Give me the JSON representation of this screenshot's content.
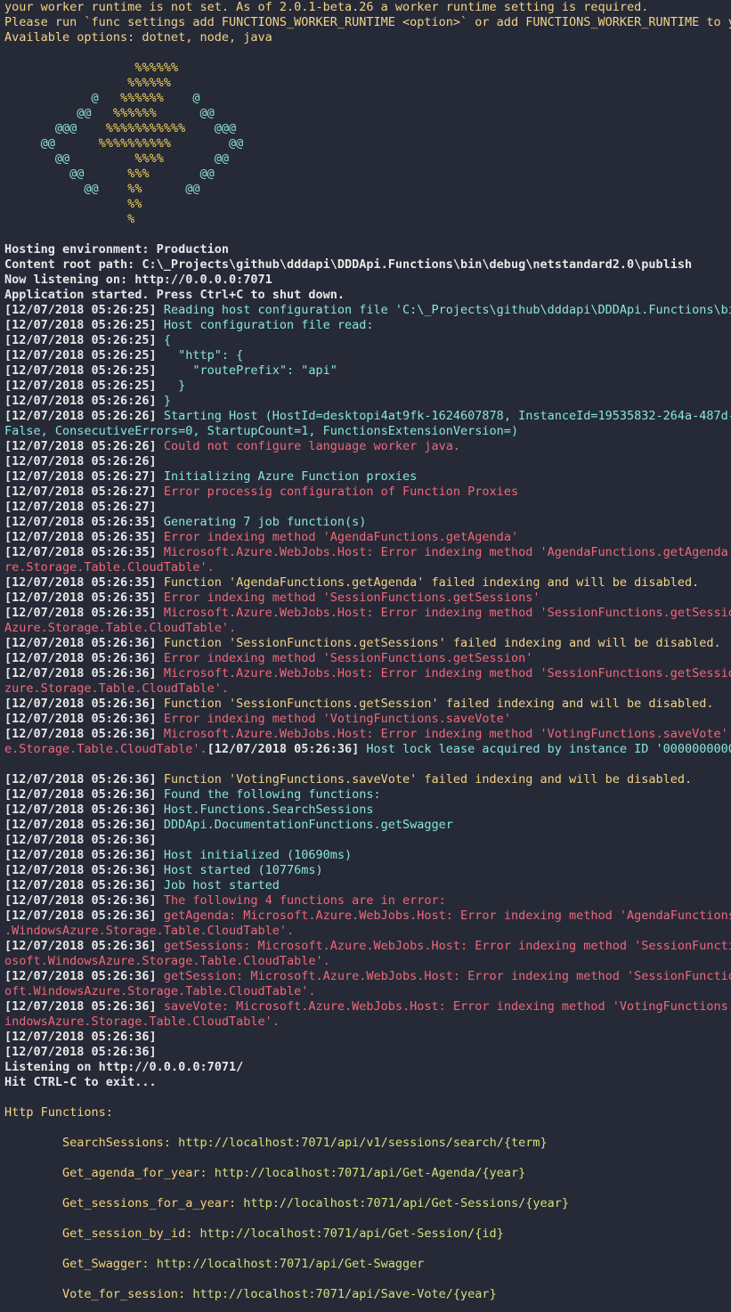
{
  "colors": {
    "background": "#262a36",
    "white": "#e8e8e8",
    "yellow": "#f2d388",
    "cyan": "#86e5dc",
    "red": "#f0677a",
    "lime": "#d2e07a",
    "logo_percent": "#f4d35e",
    "logo_at": "#8ee0d4"
  },
  "lines": [
    [
      {
        "t": "your worker runtime is not set. As of 2.0.1-beta.26 a worker runtime setting is required.",
        "c": "yellow"
      }
    ],
    [
      {
        "t": "Please run `func settings add FUNCTIONS_WORKER_RUNTIME <option>` or add FUNCTIONS_WORKER_RUNTIME to y",
        "c": "yellow"
      }
    ],
    [
      {
        "t": "Available options: dotnet, node, java",
        "c": "yellow"
      }
    ],
    [
      {
        "t": "",
        "c": "white"
      }
    ],
    [
      {
        "t": "                  ",
        "c": "white"
      },
      {
        "t": "%%%%%%",
        "c": "logo-pct"
      }
    ],
    [
      {
        "t": "                 ",
        "c": "white"
      },
      {
        "t": "%%%%%%",
        "c": "logo-pct"
      }
    ],
    [
      {
        "t": "            ",
        "c": "white"
      },
      {
        "t": "@",
        "c": "logo-at"
      },
      {
        "t": "   ",
        "c": "white"
      },
      {
        "t": "%%%%%%",
        "c": "logo-pct"
      },
      {
        "t": "    ",
        "c": "white"
      },
      {
        "t": "@",
        "c": "logo-at"
      }
    ],
    [
      {
        "t": "          ",
        "c": "white"
      },
      {
        "t": "@@",
        "c": "logo-at"
      },
      {
        "t": "   ",
        "c": "white"
      },
      {
        "t": "%%%%%%",
        "c": "logo-pct"
      },
      {
        "t": "      ",
        "c": "white"
      },
      {
        "t": "@@",
        "c": "logo-at"
      }
    ],
    [
      {
        "t": "       ",
        "c": "white"
      },
      {
        "t": "@@@",
        "c": "logo-at"
      },
      {
        "t": "    ",
        "c": "white"
      },
      {
        "t": "%%%%%%%%%%%",
        "c": "logo-pct"
      },
      {
        "t": "    ",
        "c": "white"
      },
      {
        "t": "@@@",
        "c": "logo-at"
      }
    ],
    [
      {
        "t": "     ",
        "c": "white"
      },
      {
        "t": "@@",
        "c": "logo-at"
      },
      {
        "t": "      ",
        "c": "white"
      },
      {
        "t": "%%%%%%%%%%",
        "c": "logo-pct"
      },
      {
        "t": "        ",
        "c": "white"
      },
      {
        "t": "@@",
        "c": "logo-at"
      }
    ],
    [
      {
        "t": "       ",
        "c": "white"
      },
      {
        "t": "@@",
        "c": "logo-at"
      },
      {
        "t": "         ",
        "c": "white"
      },
      {
        "t": "%%%%",
        "c": "logo-pct"
      },
      {
        "t": "       ",
        "c": "white"
      },
      {
        "t": "@@",
        "c": "logo-at"
      }
    ],
    [
      {
        "t": "         ",
        "c": "white"
      },
      {
        "t": "@@",
        "c": "logo-at"
      },
      {
        "t": "      ",
        "c": "white"
      },
      {
        "t": "%%%",
        "c": "logo-pct"
      },
      {
        "t": "       ",
        "c": "white"
      },
      {
        "t": "@@",
        "c": "logo-at"
      }
    ],
    [
      {
        "t": "           ",
        "c": "white"
      },
      {
        "t": "@@",
        "c": "logo-at"
      },
      {
        "t": "    ",
        "c": "white"
      },
      {
        "t": "%%",
        "c": "logo-pct"
      },
      {
        "t": "      ",
        "c": "white"
      },
      {
        "t": "@@",
        "c": "logo-at"
      }
    ],
    [
      {
        "t": "                 ",
        "c": "white"
      },
      {
        "t": "%%",
        "c": "logo-pct"
      }
    ],
    [
      {
        "t": "                 ",
        "c": "white"
      },
      {
        "t": "%",
        "c": "logo-pct"
      }
    ],
    [
      {
        "t": "",
        "c": "white"
      }
    ],
    [
      {
        "t": "Hosting environment: Production",
        "c": "bold-white"
      }
    ],
    [
      {
        "t": "Content root path: C:\\_Projects\\github\\dddapi\\DDDApi.Functions\\bin\\debug\\netstandard2.0\\publish",
        "c": "bold-white"
      }
    ],
    [
      {
        "t": "Now listening on: http://0.0.0.0:7071",
        "c": "bold-white"
      }
    ],
    [
      {
        "t": "Application started. Press Ctrl+C to shut down.",
        "c": "bold-white"
      }
    ],
    [
      {
        "t": "[12/07/2018 05:26:25] ",
        "c": "bold-white"
      },
      {
        "t": "Reading host configuration file 'C:\\_Projects\\github\\dddapi\\DDDApi.Functions\\bi",
        "c": "cyan"
      }
    ],
    [
      {
        "t": "[12/07/2018 05:26:25] ",
        "c": "bold-white"
      },
      {
        "t": "Host configuration file read:",
        "c": "cyan"
      }
    ],
    [
      {
        "t": "[12/07/2018 05:26:25] ",
        "c": "bold-white"
      },
      {
        "t": "{",
        "c": "cyan"
      }
    ],
    [
      {
        "t": "[12/07/2018 05:26:25] ",
        "c": "bold-white"
      },
      {
        "t": "  \"http\": {",
        "c": "cyan"
      }
    ],
    [
      {
        "t": "[12/07/2018 05:26:25] ",
        "c": "bold-white"
      },
      {
        "t": "    \"routePrefix\": \"api\"",
        "c": "cyan"
      }
    ],
    [
      {
        "t": "[12/07/2018 05:26:25] ",
        "c": "bold-white"
      },
      {
        "t": "  }",
        "c": "cyan"
      }
    ],
    [
      {
        "t": "[12/07/2018 05:26:26] ",
        "c": "bold-white"
      },
      {
        "t": "}",
        "c": "cyan"
      }
    ],
    [
      {
        "t": "[12/07/2018 05:26:26] ",
        "c": "bold-white"
      },
      {
        "t": "Starting Host (HostId=desktopi4at9fk-1624607878, InstanceId=19535832-264a-487d-",
        "c": "cyan"
      }
    ],
    [
      {
        "t": "False, ConsecutiveErrors=0, StartupCount=1, FunctionsExtensionVersion=)",
        "c": "cyan"
      }
    ],
    [
      {
        "t": "[12/07/2018 05:26:26] ",
        "c": "bold-white"
      },
      {
        "t": "Could not configure language worker java.",
        "c": "red"
      }
    ],
    [
      {
        "t": "[12/07/2018 05:26:26]",
        "c": "bold-white"
      }
    ],
    [
      {
        "t": "[12/07/2018 05:26:27] ",
        "c": "bold-white"
      },
      {
        "t": "Initializing Azure Function proxies",
        "c": "cyan"
      }
    ],
    [
      {
        "t": "[12/07/2018 05:26:27] ",
        "c": "bold-white"
      },
      {
        "t": "Error processig configuration of Function Proxies",
        "c": "red"
      }
    ],
    [
      {
        "t": "[12/07/2018 05:26:27]",
        "c": "bold-white"
      }
    ],
    [
      {
        "t": "[12/07/2018 05:26:35] ",
        "c": "bold-white"
      },
      {
        "t": "Generating 7 job function(s)",
        "c": "cyan"
      }
    ],
    [
      {
        "t": "[12/07/2018 05:26:35] ",
        "c": "bold-white"
      },
      {
        "t": "Error indexing method 'AgendaFunctions.getAgenda'",
        "c": "red"
      }
    ],
    [
      {
        "t": "[12/07/2018 05:26:35] ",
        "c": "bold-white"
      },
      {
        "t": "Microsoft.Azure.WebJobs.Host: Error indexing method 'AgendaFunctions.getAgenda'",
        "c": "red"
      }
    ],
    [
      {
        "t": "re.Storage.Table.CloudTable'.",
        "c": "red"
      }
    ],
    [
      {
        "t": "[12/07/2018 05:26:35] ",
        "c": "bold-white"
      },
      {
        "t": "Function 'AgendaFunctions.getAgenda' failed indexing and will be disabled.",
        "c": "yellow"
      }
    ],
    [
      {
        "t": "[12/07/2018 05:26:35] ",
        "c": "bold-white"
      },
      {
        "t": "Error indexing method 'SessionFunctions.getSessions'",
        "c": "red"
      }
    ],
    [
      {
        "t": "[12/07/2018 05:26:35] ",
        "c": "bold-white"
      },
      {
        "t": "Microsoft.Azure.WebJobs.Host: Error indexing method 'SessionFunctions.getSessio",
        "c": "red"
      }
    ],
    [
      {
        "t": "Azure.Storage.Table.CloudTable'.",
        "c": "red"
      }
    ],
    [
      {
        "t": "[12/07/2018 05:26:36] ",
        "c": "bold-white"
      },
      {
        "t": "Function 'SessionFunctions.getSessions' failed indexing and will be disabled.",
        "c": "yellow"
      }
    ],
    [
      {
        "t": "[12/07/2018 05:26:36] ",
        "c": "bold-white"
      },
      {
        "t": "Error indexing method 'SessionFunctions.getSession'",
        "c": "red"
      }
    ],
    [
      {
        "t": "[12/07/2018 05:26:36] ",
        "c": "bold-white"
      },
      {
        "t": "Microsoft.Azure.WebJobs.Host: Error indexing method 'SessionFunctions.getSessio",
        "c": "red"
      }
    ],
    [
      {
        "t": "zure.Storage.Table.CloudTable'.",
        "c": "red"
      }
    ],
    [
      {
        "t": "[12/07/2018 05:26:36] ",
        "c": "bold-white"
      },
      {
        "t": "Function 'SessionFunctions.getSession' failed indexing and will be disabled.",
        "c": "yellow"
      }
    ],
    [
      {
        "t": "[12/07/2018 05:26:36] ",
        "c": "bold-white"
      },
      {
        "t": "Error indexing method 'VotingFunctions.saveVote'",
        "c": "red"
      }
    ],
    [
      {
        "t": "[12/07/2018 05:26:36] ",
        "c": "bold-white"
      },
      {
        "t": "Microsoft.Azure.WebJobs.Host: Error indexing method 'VotingFunctions.saveVote'.",
        "c": "red"
      }
    ],
    [
      {
        "t": "e.Storage.Table.CloudTable'.",
        "c": "red"
      },
      {
        "t": "[12/07/2018 05:26:36] ",
        "c": "bold-white"
      },
      {
        "t": "Host lock lease acquired by instance ID '0000000000",
        "c": "cyan"
      }
    ],
    [
      {
        "t": "",
        "c": "white"
      }
    ],
    [
      {
        "t": "[12/07/2018 05:26:36] ",
        "c": "bold-white"
      },
      {
        "t": "Function 'VotingFunctions.saveVote' failed indexing and will be disabled.",
        "c": "yellow"
      }
    ],
    [
      {
        "t": "[12/07/2018 05:26:36] ",
        "c": "bold-white"
      },
      {
        "t": "Found the following functions:",
        "c": "cyan"
      }
    ],
    [
      {
        "t": "[12/07/2018 05:26:36] ",
        "c": "bold-white"
      },
      {
        "t": "Host.Functions.SearchSessions",
        "c": "cyan"
      }
    ],
    [
      {
        "t": "[12/07/2018 05:26:36] ",
        "c": "bold-white"
      },
      {
        "t": "DDDApi.DocumentationFunctions.getSwagger",
        "c": "cyan"
      }
    ],
    [
      {
        "t": "[12/07/2018 05:26:36]",
        "c": "bold-white"
      }
    ],
    [
      {
        "t": "[12/07/2018 05:26:36] ",
        "c": "bold-white"
      },
      {
        "t": "Host initialized (10690ms)",
        "c": "cyan"
      }
    ],
    [
      {
        "t": "[12/07/2018 05:26:36] ",
        "c": "bold-white"
      },
      {
        "t": "Host started (10776ms)",
        "c": "cyan"
      }
    ],
    [
      {
        "t": "[12/07/2018 05:26:36] ",
        "c": "bold-white"
      },
      {
        "t": "Job host started",
        "c": "cyan"
      }
    ],
    [
      {
        "t": "[12/07/2018 05:26:36] ",
        "c": "bold-white"
      },
      {
        "t": "The following 4 functions are in error:",
        "c": "red"
      }
    ],
    [
      {
        "t": "[12/07/2018 05:26:36] ",
        "c": "bold-white"
      },
      {
        "t": "getAgenda: Microsoft.Azure.WebJobs.Host: Error indexing method 'AgendaFunctions",
        "c": "red"
      }
    ],
    [
      {
        "t": ".WindowsAzure.Storage.Table.CloudTable'.",
        "c": "red"
      }
    ],
    [
      {
        "t": "[12/07/2018 05:26:36] ",
        "c": "bold-white"
      },
      {
        "t": "getSessions: Microsoft.Azure.WebJobs.Host: Error indexing method 'SessionFuncti",
        "c": "red"
      }
    ],
    [
      {
        "t": "osoft.WindowsAzure.Storage.Table.CloudTable'.",
        "c": "red"
      }
    ],
    [
      {
        "t": "[12/07/2018 05:26:36] ",
        "c": "bold-white"
      },
      {
        "t": "getSession: Microsoft.Azure.WebJobs.Host: Error indexing method 'SessionFunctio",
        "c": "red"
      }
    ],
    [
      {
        "t": "oft.WindowsAzure.Storage.Table.CloudTable'.",
        "c": "red"
      }
    ],
    [
      {
        "t": "[12/07/2018 05:26:36] ",
        "c": "bold-white"
      },
      {
        "t": "saveVote: Microsoft.Azure.WebJobs.Host: Error indexing method 'VotingFunctions.",
        "c": "red"
      }
    ],
    [
      {
        "t": "indowsAzure.Storage.Table.CloudTable'.",
        "c": "red"
      }
    ],
    [
      {
        "t": "[12/07/2018 05:26:36]",
        "c": "bold-white"
      }
    ],
    [
      {
        "t": "[12/07/2018 05:26:36]",
        "c": "bold-white"
      }
    ],
    [
      {
        "t": "Listening on http://0.0.0.0:7071/",
        "c": "bold-white"
      }
    ],
    [
      {
        "t": "Hit CTRL-C to exit...",
        "c": "bold-white"
      }
    ],
    [
      {
        "t": "",
        "c": "white"
      }
    ],
    [
      {
        "t": "Http Functions:",
        "c": "yellow"
      }
    ],
    [
      {
        "t": "",
        "c": "white"
      }
    ],
    [
      {
        "t": "        SearchSessions: ",
        "c": "orange"
      },
      {
        "t": "http://localhost:7071/api/v1/sessions/search/{term}",
        "c": "lime"
      }
    ],
    [
      {
        "t": "",
        "c": "white"
      }
    ],
    [
      {
        "t": "        Get_agenda_for_year: ",
        "c": "orange"
      },
      {
        "t": "http://localhost:7071/api/Get-Agenda/{year}",
        "c": "lime"
      }
    ],
    [
      {
        "t": "",
        "c": "white"
      }
    ],
    [
      {
        "t": "        Get_sessions_for_a_year: ",
        "c": "orange"
      },
      {
        "t": "http://localhost:7071/api/Get-Sessions/{year}",
        "c": "lime"
      }
    ],
    [
      {
        "t": "",
        "c": "white"
      }
    ],
    [
      {
        "t": "        Get_session_by_id: ",
        "c": "orange"
      },
      {
        "t": "http://localhost:7071/api/Get-Session/{id}",
        "c": "lime"
      }
    ],
    [
      {
        "t": "",
        "c": "white"
      }
    ],
    [
      {
        "t": "        Get_Swagger: ",
        "c": "orange"
      },
      {
        "t": "http://localhost:7071/api/Get-Swagger",
        "c": "lime"
      }
    ],
    [
      {
        "t": "",
        "c": "white"
      }
    ],
    [
      {
        "t": "        Vote_for_session: ",
        "c": "orange"
      },
      {
        "t": "http://localhost:7071/api/Save-Vote/{year}",
        "c": "lime"
      }
    ]
  ]
}
